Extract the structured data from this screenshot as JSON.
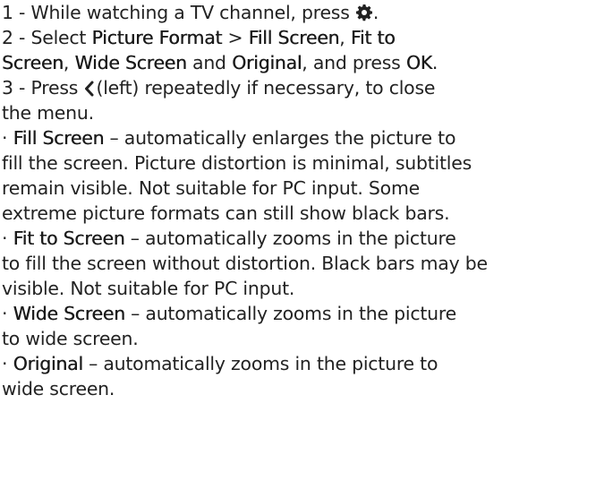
{
  "steps": [
    {
      "num": "1 -",
      "text": " While watching a TV channel, press ",
      "icon": "gear-icon",
      "tail": "."
    },
    {
      "num": "2 -",
      "pre": " Select ",
      "picture_format": "Picture Format",
      "gt": " > ",
      "fill_screen": "Fill Screen",
      "sep1": ", ",
      "fit_to_screen": "Fit to Screen",
      "sep2": ", ",
      "wide_screen": "Wide Screen",
      "and": " and ",
      "original": "Original",
      "mid": ", and press ",
      "ok": "OK",
      "end": "."
    },
    {
      "num": "3 -",
      "pre": " Press ",
      "icon": "chevron-left-icon",
      "post": " (left) repeatedly if necessary, to close the menu."
    }
  ],
  "bullets": [
    {
      "term": "Fill Screen",
      "desc": " – automatically enlarges the picture to fill the screen. Picture distortion is minimal, subtitles remain visible. Not suitable for PC input. Some extreme picture formats can still show black bars."
    },
    {
      "term": "Fit to Screen",
      "desc": " – automatically zooms in the picture to fill the screen without distortion. Black bars may be visible. Not suitable for PC input."
    },
    {
      "term": "Wide Screen",
      "desc": " – automatically zooms in the picture to wide screen."
    },
    {
      "term": "Original",
      "desc": " – automatically zooms in the picture to wide screen."
    }
  ],
  "bullet_char": "·"
}
